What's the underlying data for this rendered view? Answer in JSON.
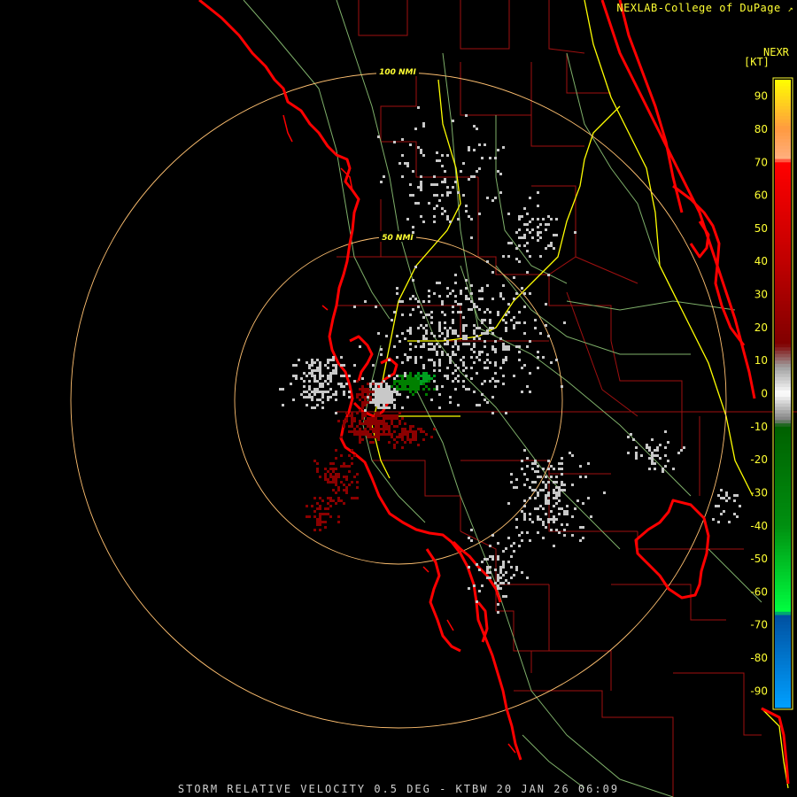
{
  "credit": "NEXLAB-College of DuPage",
  "product_code": "NEXR",
  "units": "[KT]",
  "caption": "STORM RELATIVE VELOCITY 0.5 DEG - KTBW 20 JAN 26 06:09",
  "range_rings": [
    {
      "label": "50 NMI",
      "range_nmi": 50
    },
    {
      "label": "100 NMI",
      "range_nmi": 100
    }
  ],
  "colorbar": {
    "ticks": [
      90,
      80,
      70,
      60,
      50,
      40,
      30,
      20,
      10,
      0,
      -10,
      -20,
      -30,
      -40,
      -50,
      -60,
      -70,
      -80,
      -90
    ],
    "min": -95,
    "max": 95,
    "stops": [
      {
        "value": 95,
        "color": "#ffff00"
      },
      {
        "value": 80,
        "color": "#ff9a40"
      },
      {
        "value": 71,
        "color": "#ffb080"
      },
      {
        "value": 70,
        "color": "#ff0000"
      },
      {
        "value": 40,
        "color": "#c00000"
      },
      {
        "value": 15,
        "color": "#800000"
      },
      {
        "value": 8,
        "color": "#a0a0a0"
      },
      {
        "value": 0,
        "color": "#ffffff"
      },
      {
        "value": -8,
        "color": "#808080"
      },
      {
        "value": -10,
        "color": "#006000"
      },
      {
        "value": -40,
        "color": "#009010"
      },
      {
        "value": -66,
        "color": "#00ff40"
      },
      {
        "value": -67,
        "color": "#0050a0"
      },
      {
        "value": -95,
        "color": "#00a0ff"
      }
    ]
  },
  "colors": {
    "coast": "#ff0000",
    "county": "#aa1010",
    "highway_major": "#ffff00",
    "highway_minor": "#88c070",
    "ring": "#ffc070",
    "inbound": "#008000",
    "outbound": "#8b0000",
    "near_zero": "#c8c8c8"
  }
}
